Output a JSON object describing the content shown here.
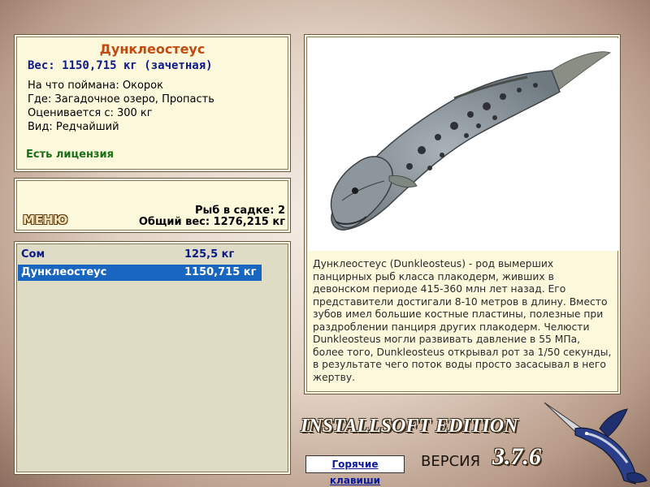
{
  "fish": {
    "name": "Дунклеостеус",
    "weight_line": "Вес: 1150,715 кг (зачетная)",
    "bait_line": "На что поймана: Окорок",
    "place_line": "Где: Загадочное озеро, Пропасть",
    "rated_line": "Оценивается с: 300 кг",
    "kind_line": "Вид: Редчайший",
    "license": "Есть лицензия",
    "description": "Дунклеостеус (Dunkleosteus) - род вымерших панцирных рыб класса плакодерм, живших в девонском периоде 415-360 млн лет назад. Его представители достигали 8-10 метров в длину. Вместо зубов имел большие костные пластины, полезные при раздроблении панциря других плакодерм. Челюсти Dunkleosteus могли развивать давление в 55 МПа, более того, Dunkleosteus открывал рот за 1/50 секунды, в результате чего поток воды просто засасывал в него жертву."
  },
  "cage": {
    "menu_label": "МЕНЮ",
    "count_line": "Рыб в садке: 2",
    "total_line": "Общий вес: 1276,215 кг"
  },
  "list": [
    {
      "name": "Сом",
      "weight": "125,5 кг",
      "selected": false
    },
    {
      "name": "Дунклеостеус",
      "weight": "1150,715 кг",
      "selected": true
    }
  ],
  "footer": {
    "brand": "INSTALLSOFT EDITION",
    "version_label": "ВЕРСИЯ",
    "version_number": "3.7.6",
    "hotkeys_label": "Горячие клавиши"
  },
  "colors": {
    "panel_bg": "#fbf8dc",
    "title": "#c24a10",
    "weight": "#0c1a8a",
    "license": "#1a6e16",
    "selection": "#1866c0"
  },
  "icons": {
    "fish_picture": "dunkleosteus-illustration",
    "logo": "marlin-logo"
  }
}
